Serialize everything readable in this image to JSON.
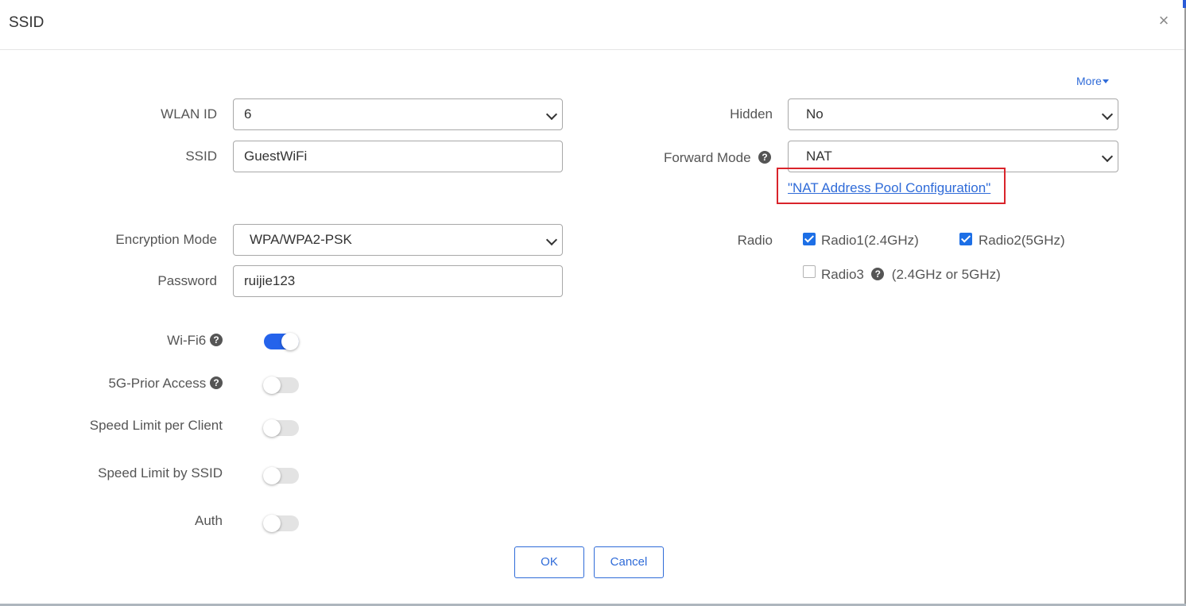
{
  "dialog": {
    "title": "SSID",
    "close_glyph": "×"
  },
  "more": {
    "label": "More"
  },
  "form": {
    "wlan_id": {
      "label": "WLAN ID",
      "value": "6"
    },
    "ssid": {
      "label": "SSID",
      "value": "GuestWiFi"
    },
    "encryption_mode": {
      "label": "Encryption Mode",
      "value": "WPA/WPA2-PSK"
    },
    "password": {
      "label": "Password",
      "value": "ruijie123"
    },
    "hidden": {
      "label": "Hidden",
      "value": "No"
    },
    "forward_mode": {
      "label": "Forward Mode",
      "value": "NAT"
    },
    "nat_pool_link": "\"NAT Address Pool Configuration\"",
    "radio": {
      "label": "Radio",
      "options": [
        {
          "label": "Radio1(2.4GHz)",
          "checked": true
        },
        {
          "label": "Radio2(5GHz)",
          "checked": true
        },
        {
          "label": "Radio3",
          "suffix": "(2.4GHz or 5GHz)",
          "checked": false
        }
      ]
    },
    "toggles": [
      {
        "label": "Wi-Fi6",
        "on": true
      },
      {
        "label": "5G-Prior Access",
        "on": false
      },
      {
        "label": "Speed Limit per Client",
        "on": false
      },
      {
        "label": "Speed Limit by SSID",
        "on": false
      },
      {
        "label": "Auth",
        "on": false
      }
    ]
  },
  "buttons": {
    "ok": "OK",
    "cancel": "Cancel"
  },
  "colors": {
    "accent": "#2f6bd8",
    "highlight_border": "#d9242b",
    "toggle_on": "#2563eb",
    "checkbox_on": "#1d6fe6"
  }
}
